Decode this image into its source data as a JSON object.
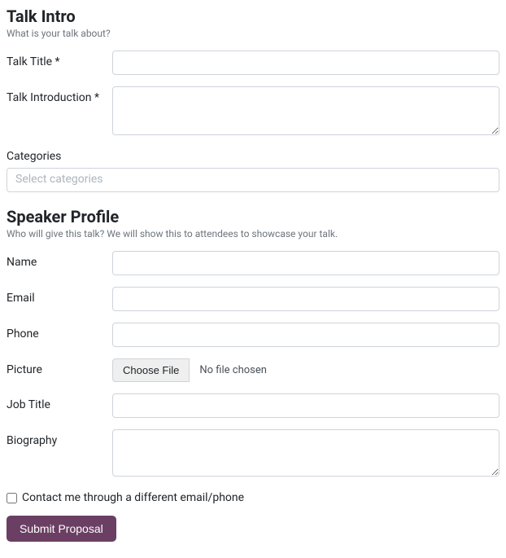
{
  "intro": {
    "heading": "Talk Intro",
    "subheading": "What is your talk about?",
    "talkTitleLabel": "Talk Title *",
    "talkIntroLabel": "Talk Introduction *",
    "categoriesLabel": "Categories",
    "categoriesPlaceholder": "Select categories"
  },
  "profile": {
    "heading": "Speaker Profile",
    "subheading": "Who will give this talk? We will show this to attendees to showcase your talk.",
    "nameLabel": "Name",
    "emailLabel": "Email",
    "phoneLabel": "Phone",
    "pictureLabel": "Picture",
    "chooseFileButton": "Choose File",
    "noFileChosen": "No file chosen",
    "jobTitleLabel": "Job Title",
    "biographyLabel": "Biography"
  },
  "contactCheckboxLabel": "Contact me through a different email/phone",
  "submitButtonLabel": "Submit Proposal"
}
